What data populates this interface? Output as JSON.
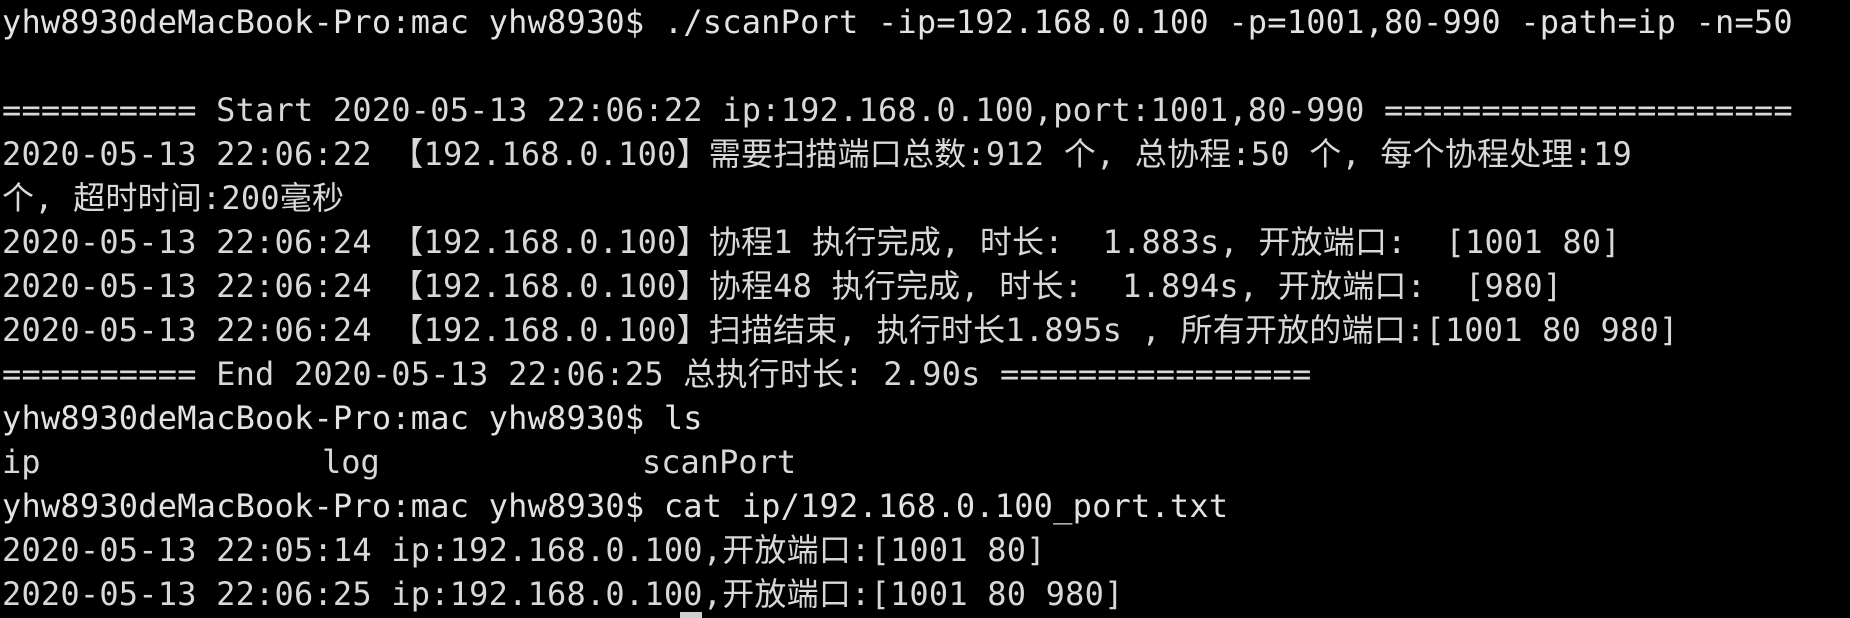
{
  "terminal": {
    "lines": [
      "yhw8930deMacBook-Pro:mac yhw8930$ ./scanPort -ip=192.168.0.100 -p=1001,80-990 -path=ip -n=50",
      "",
      "========== Start 2020-05-13 22:06:22 ip:192.168.0.100,port:1001,80-990 =====================",
      "2020-05-13 22:06:22 【192.168.0.100】需要扫描端口总数:912 个, 总协程:50 个, 每个协程处理:19",
      "个, 超时时间:200毫秒",
      "2020-05-13 22:06:24 【192.168.0.100】协程1 执行完成, 时长:  1.883s, 开放端口:  [1001 80]",
      "2020-05-13 22:06:24 【192.168.0.100】协程48 执行完成, 时长:  1.894s, 开放端口:  [980]",
      "2020-05-13 22:06:24 【192.168.0.100】扫描结束, 执行时长1.895s , 所有开放的端口:[1001 80 980]",
      "========== End 2020-05-13 22:06:25 总执行时长: 2.90s ================",
      "yhw8930deMacBook-Pro:mac yhw8930$ ls"
    ],
    "ls_output": [
      "ip",
      "log",
      "scanPort"
    ],
    "lines_after": [
      "yhw8930deMacBook-Pro:mac yhw8930$ cat ip/192.168.0.100_port.txt",
      "2020-05-13 22:05:14 ip:192.168.0.100,开放端口:[1001 80]",
      "2020-05-13 22:06:25 ip:192.168.0.100,开放端口:[1001 80 980]"
    ]
  },
  "colors": {
    "background": "#000000",
    "foreground": "#d8d8d8"
  }
}
